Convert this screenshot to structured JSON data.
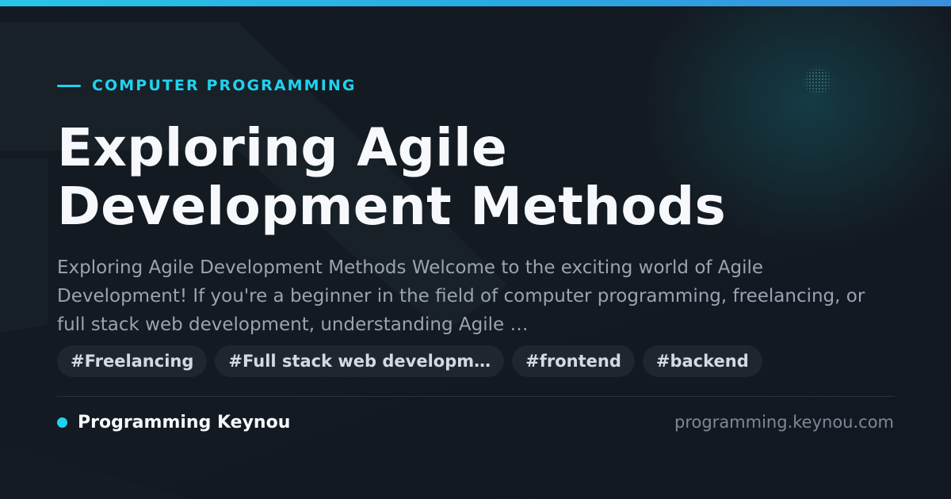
{
  "theme": {
    "accent": "#1fd3ef",
    "background": "#131821",
    "title_color": "#f6f8fb",
    "text_muted": "#9aa3b0",
    "tag_background": "#1f2630",
    "top_bar_gradient": [
      "#29c4e8",
      "#3a8fdc"
    ]
  },
  "category": {
    "label": "COMPUTER PROGRAMMING",
    "icon": "accent-line"
  },
  "title": {
    "line1": "Exploring Agile",
    "line2": "Development Methods"
  },
  "summary": "Exploring Agile Development Methods Welcome to the exciting world of Agile Development! If you're a beginner in the field of computer programming, freelancing, or full stack web development, understanding Agile …",
  "tags": [
    "#Freelancing",
    "#Full stack web developm…",
    "#frontend",
    "#backend"
  ],
  "footer": {
    "brand_name": "Programming Keynou",
    "brand_icon": "status-dot",
    "site_url": "programming.keynou.com"
  }
}
